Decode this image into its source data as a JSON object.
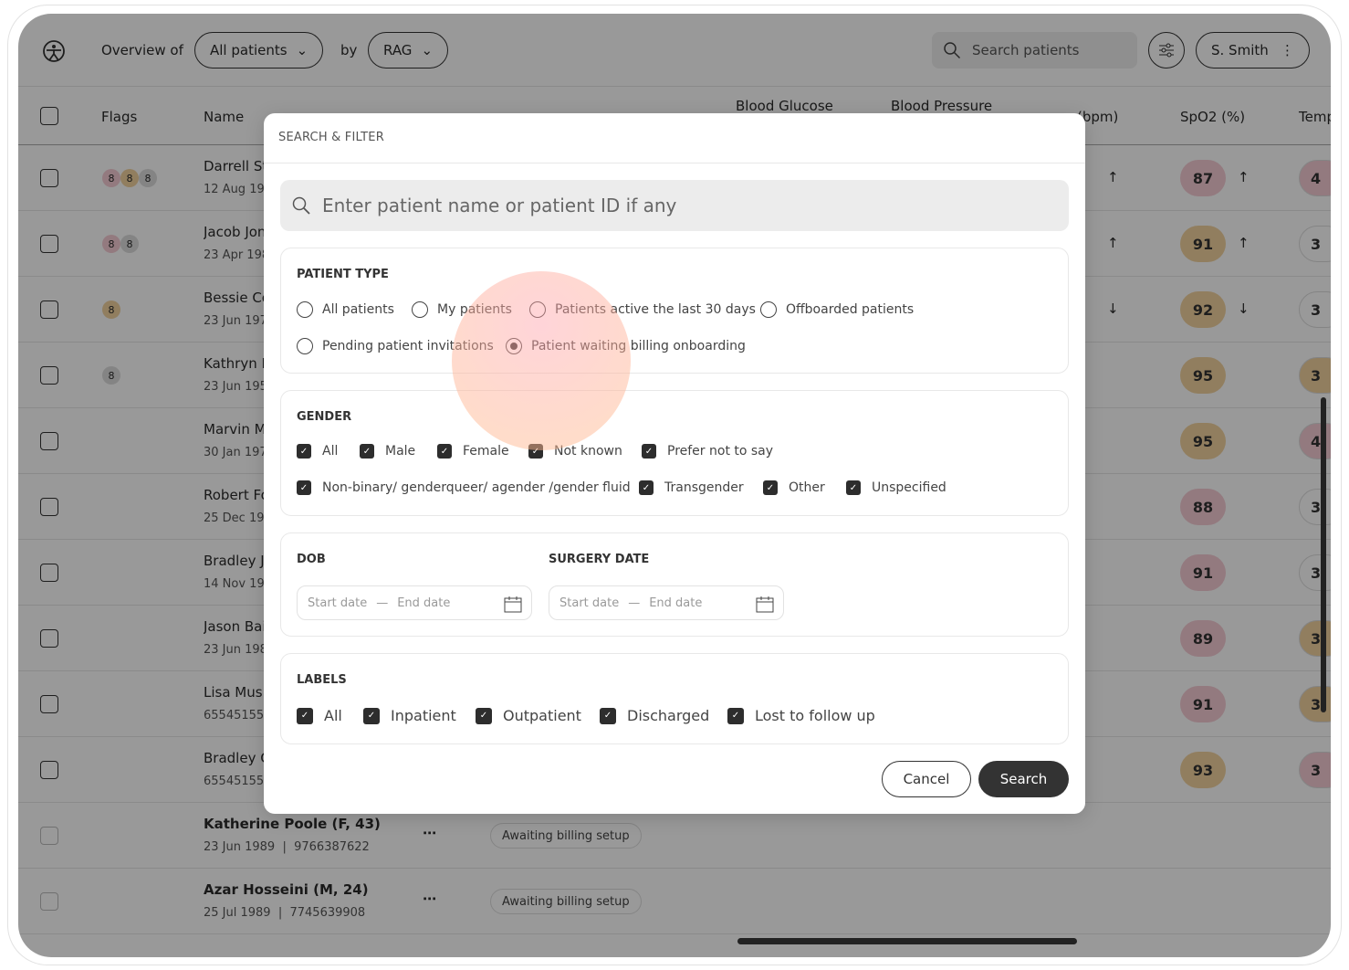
{
  "topbar": {
    "overview_label": "Overview of",
    "scope_select": "All patients",
    "by_label": "by",
    "group_select": "RAG",
    "search_placeholder": "Search patients",
    "user": "S. Smith"
  },
  "table": {
    "headers": {
      "flags": "Flags",
      "name": "Name",
      "blood_glucose": "Blood Glucose",
      "blood_pressure": "Blood Pressure",
      "pulse": "(bpm)",
      "spo2": "SpO2 (%)",
      "temp": "Temp"
    },
    "rows": [
      {
        "name": "Darrell St",
        "sub": "12 Aug 19",
        "flags": [
          {
            "v": "8",
            "c": "pink"
          },
          {
            "v": "8",
            "c": "amber"
          },
          {
            "v": "8",
            "c": "grey"
          }
        ],
        "pulse_trend": "↑",
        "spo2": "87",
        "spo2_c": "pink",
        "spo2_trend": "↑",
        "temp": "4",
        "temp_c": "pink"
      },
      {
        "name": "Jacob Jon",
        "sub": "23 Apr 198",
        "flags": [
          {
            "v": "8",
            "c": "pink"
          },
          {
            "v": "8",
            "c": "grey"
          }
        ],
        "pulse_trend": "↑",
        "spo2": "91",
        "spo2_c": "amber",
        "spo2_trend": "↑",
        "temp": "3",
        "temp_c": ""
      },
      {
        "name": "Bessie Co",
        "sub": "23 Jun 197",
        "flags": [
          {
            "v": "8",
            "c": "amber"
          }
        ],
        "pulse_trend": "↓",
        "spo2": "92",
        "spo2_c": "amber",
        "spo2_trend": "↓",
        "temp": "3",
        "temp_c": ""
      },
      {
        "name": "Kathryn M",
        "sub": "23 Jun 195",
        "flags": [
          {
            "v": "8",
            "c": "grey"
          }
        ],
        "pulse_trend": "",
        "spo2": "95",
        "spo2_c": "amber",
        "spo2_trend": "",
        "temp": "3",
        "temp_c": "amber"
      },
      {
        "name": "Marvin M",
        "sub": "30 Jan 197",
        "flags": [],
        "pulse_trend": "",
        "spo2": "95",
        "spo2_c": "amber",
        "spo2_trend": "",
        "temp": "4",
        "temp_c": "pink"
      },
      {
        "name": "Robert Fo",
        "sub": "25 Dec 198",
        "flags": [],
        "pulse_trend": "",
        "spo2": "88",
        "spo2_c": "pink",
        "spo2_trend": "",
        "temp": "3",
        "temp_c": ""
      },
      {
        "name": "Bradley J",
        "sub": "14 Nov 19",
        "flags": [],
        "pulse_trend": "",
        "spo2": "91",
        "spo2_c": "pink",
        "spo2_trend": "",
        "temp": "3",
        "temp_c": ""
      },
      {
        "name": "Jason Bai",
        "sub": "23 Jun 198",
        "flags": [],
        "pulse_trend": "",
        "spo2": "89",
        "spo2_c": "pink",
        "spo2_trend": "",
        "temp": "3",
        "temp_c": "amber"
      },
      {
        "name": "Lisa Mus",
        "sub": "65545155",
        "flags": [],
        "pulse_trend": "",
        "spo2": "91",
        "spo2_c": "pink",
        "spo2_trend": "",
        "temp": "3",
        "temp_c": "amber"
      },
      {
        "name": "Bradley C",
        "sub": "65545155",
        "flags": [],
        "pulse_trend": "",
        "spo2": "93",
        "spo2_c": "amber",
        "spo2_trend": "",
        "temp": "3",
        "temp_c": "pink"
      }
    ],
    "bottom_rows": [
      {
        "name": "Katherine Poole (F, 43)",
        "sub": "23 Jun 1989  |  9766387622",
        "tag": "Awaiting billing setup"
      },
      {
        "name": "Azar Hosseini (M, 24)",
        "sub": "25 Jul 1989  |  7745639908",
        "tag": "Awaiting billing setup"
      }
    ]
  },
  "modal": {
    "title": "SEARCH & FILTER",
    "search_placeholder": "Enter patient name or patient ID if any",
    "patient_type": {
      "title": "PATIENT TYPE",
      "options": [
        "All patients",
        "My patients",
        "Patients active the last 30 days",
        "Offboarded patients",
        "Pending patient invitations",
        "Patient waiting billing onboarding"
      ],
      "selected": "Patient waiting billing onboarding"
    },
    "gender": {
      "title": "GENDER",
      "options": [
        "All",
        "Male",
        "Female",
        "Not known",
        "Prefer not to say",
        "Non-binary/ genderqueer/ agender /gender fluid",
        "Transgender",
        "Other",
        "Unspecified"
      ],
      "all_checked": true
    },
    "dob": {
      "title": "DOB",
      "start": "Start date",
      "sep": "—",
      "end": "End date"
    },
    "surgery": {
      "title": "SURGERY DATE",
      "start": "Start date",
      "sep": "—",
      "end": "End date"
    },
    "labels": {
      "title": "LABELS",
      "options": [
        "All",
        "Inpatient",
        "Outpatient",
        "Discharged",
        "Lost to follow up"
      ],
      "all_checked": true
    },
    "cancel": "Cancel",
    "search": "Search"
  },
  "colors": {
    "pink": "#f6cbd4",
    "amber": "#f2d39f",
    "grey": "#dcdcdc",
    "primary_button": "#333333"
  }
}
